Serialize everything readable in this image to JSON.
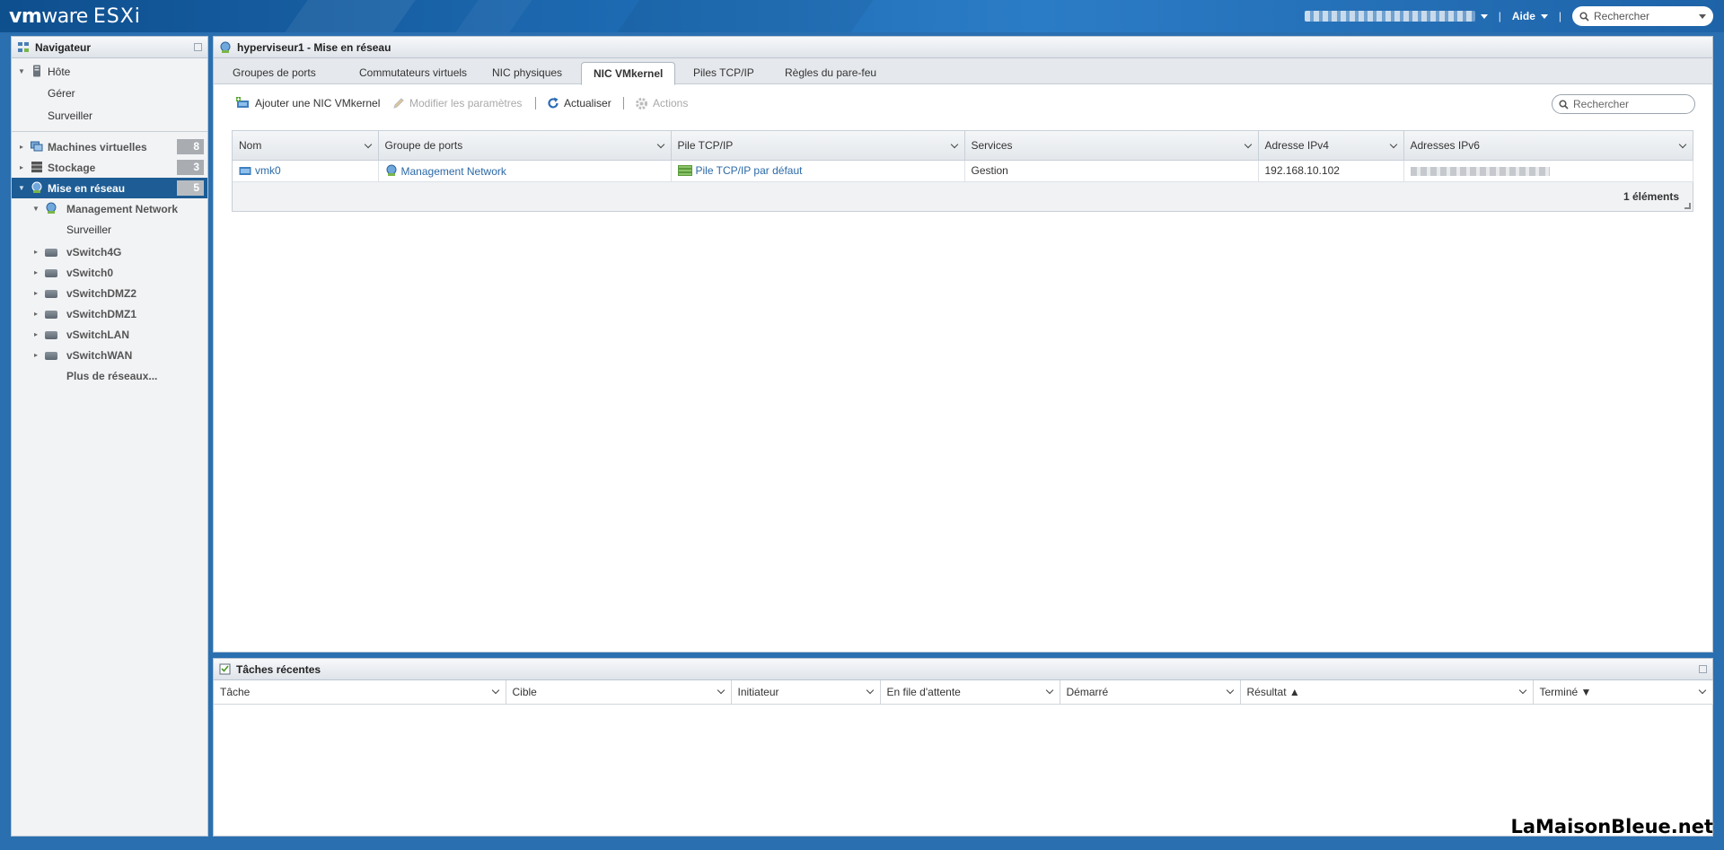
{
  "app": {
    "brand": "vm",
    "brand_suffix": "ware",
    "product": "ESXi"
  },
  "topbar": {
    "help_label": "Aide",
    "search_placeholder": "Rechercher"
  },
  "navigator": {
    "title": "Navigateur",
    "host": {
      "label": "Hôte",
      "children": [
        "Gérer",
        "Surveiller"
      ]
    },
    "items": [
      {
        "label": "Machines virtuelles",
        "count": "8"
      },
      {
        "label": "Stockage",
        "count": "3"
      },
      {
        "label": "Mise en réseau",
        "count": "5"
      }
    ],
    "network": {
      "management": "Management Network",
      "management_child": "Surveiller",
      "switches": [
        "vSwitch4G",
        "vSwitch0",
        "vSwitchDMZ2",
        "vSwitchDMZ1",
        "vSwitchLAN",
        "vSwitchWAN"
      ],
      "more": "Plus de réseaux..."
    }
  },
  "main": {
    "title": "hyperviseur1 - Mise en réseau",
    "tabs": [
      "Groupes de ports",
      "Commutateurs virtuels",
      "NIC physiques",
      "NIC VMkernel",
      "Piles TCP/IP",
      "Règles du pare-feu"
    ],
    "active_tab": "NIC VMkernel",
    "toolbar": {
      "add": "Ajouter une NIC VMkernel",
      "edit": "Modifier les paramètres",
      "refresh": "Actualiser",
      "actions": "Actions",
      "search_placeholder": "Rechercher"
    },
    "grid": {
      "columns": [
        "Nom",
        "Groupe de ports",
        "Pile TCP/IP",
        "Services",
        "Adresse IPv4",
        "Adresses IPv6"
      ],
      "rows": [
        {
          "name": "vmk0",
          "portgroup": "Management Network",
          "stack": "Pile TCP/IP par défaut",
          "services": "Gestion",
          "ipv4": "192.168.10.102"
        }
      ],
      "footer": "1 éléments"
    }
  },
  "tasks": {
    "title": "Tâches récentes",
    "columns": [
      "Tâche",
      "Cible",
      "Initiateur",
      "En file d'attente",
      "Démarré",
      "Résultat ▲",
      "Terminé ▼"
    ]
  },
  "watermark": "LaMaisonBleue.net"
}
